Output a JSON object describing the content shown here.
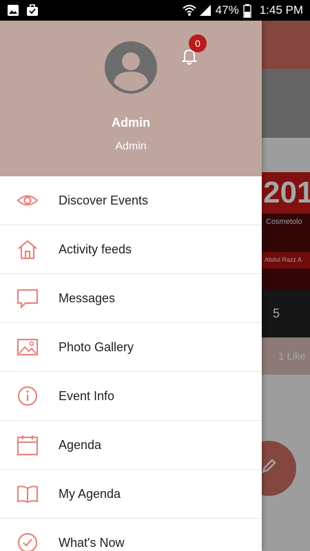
{
  "status_bar": {
    "battery": "47%",
    "time": "1:45 PM",
    "left_icons": [
      "image-icon",
      "briefcase-check-icon"
    ],
    "right_icons": [
      "wifi-icon",
      "signal-icon",
      "battery-icon"
    ]
  },
  "drawer": {
    "header": {
      "user_name": "Admin",
      "user_role": "Admin",
      "notification_count": "0"
    },
    "items": [
      {
        "label": "Discover Events",
        "icon": "eye-icon"
      },
      {
        "label": "Activity feeds",
        "icon": "home-icon"
      },
      {
        "label": "Messages",
        "icon": "message-icon"
      },
      {
        "label": "Photo Gallery",
        "icon": "image-icon"
      },
      {
        "label": "Event Info",
        "icon": "info-icon"
      },
      {
        "label": "Agenda",
        "icon": "calendar-icon"
      },
      {
        "label": "My Agenda",
        "icon": "book-icon"
      },
      {
        "label": "What's Now",
        "icon": "clock-icon"
      }
    ]
  },
  "background": {
    "card_year": "201",
    "card_subtitle": "Cosmetolo",
    "card_banner": "Abdul Razz A",
    "count": "5",
    "likes": "1 Like"
  },
  "colors": {
    "header_bg": "#bea59e",
    "icon_accent": "#e8857b",
    "badge": "#b71c1c",
    "toolbar": "#c96d63"
  }
}
